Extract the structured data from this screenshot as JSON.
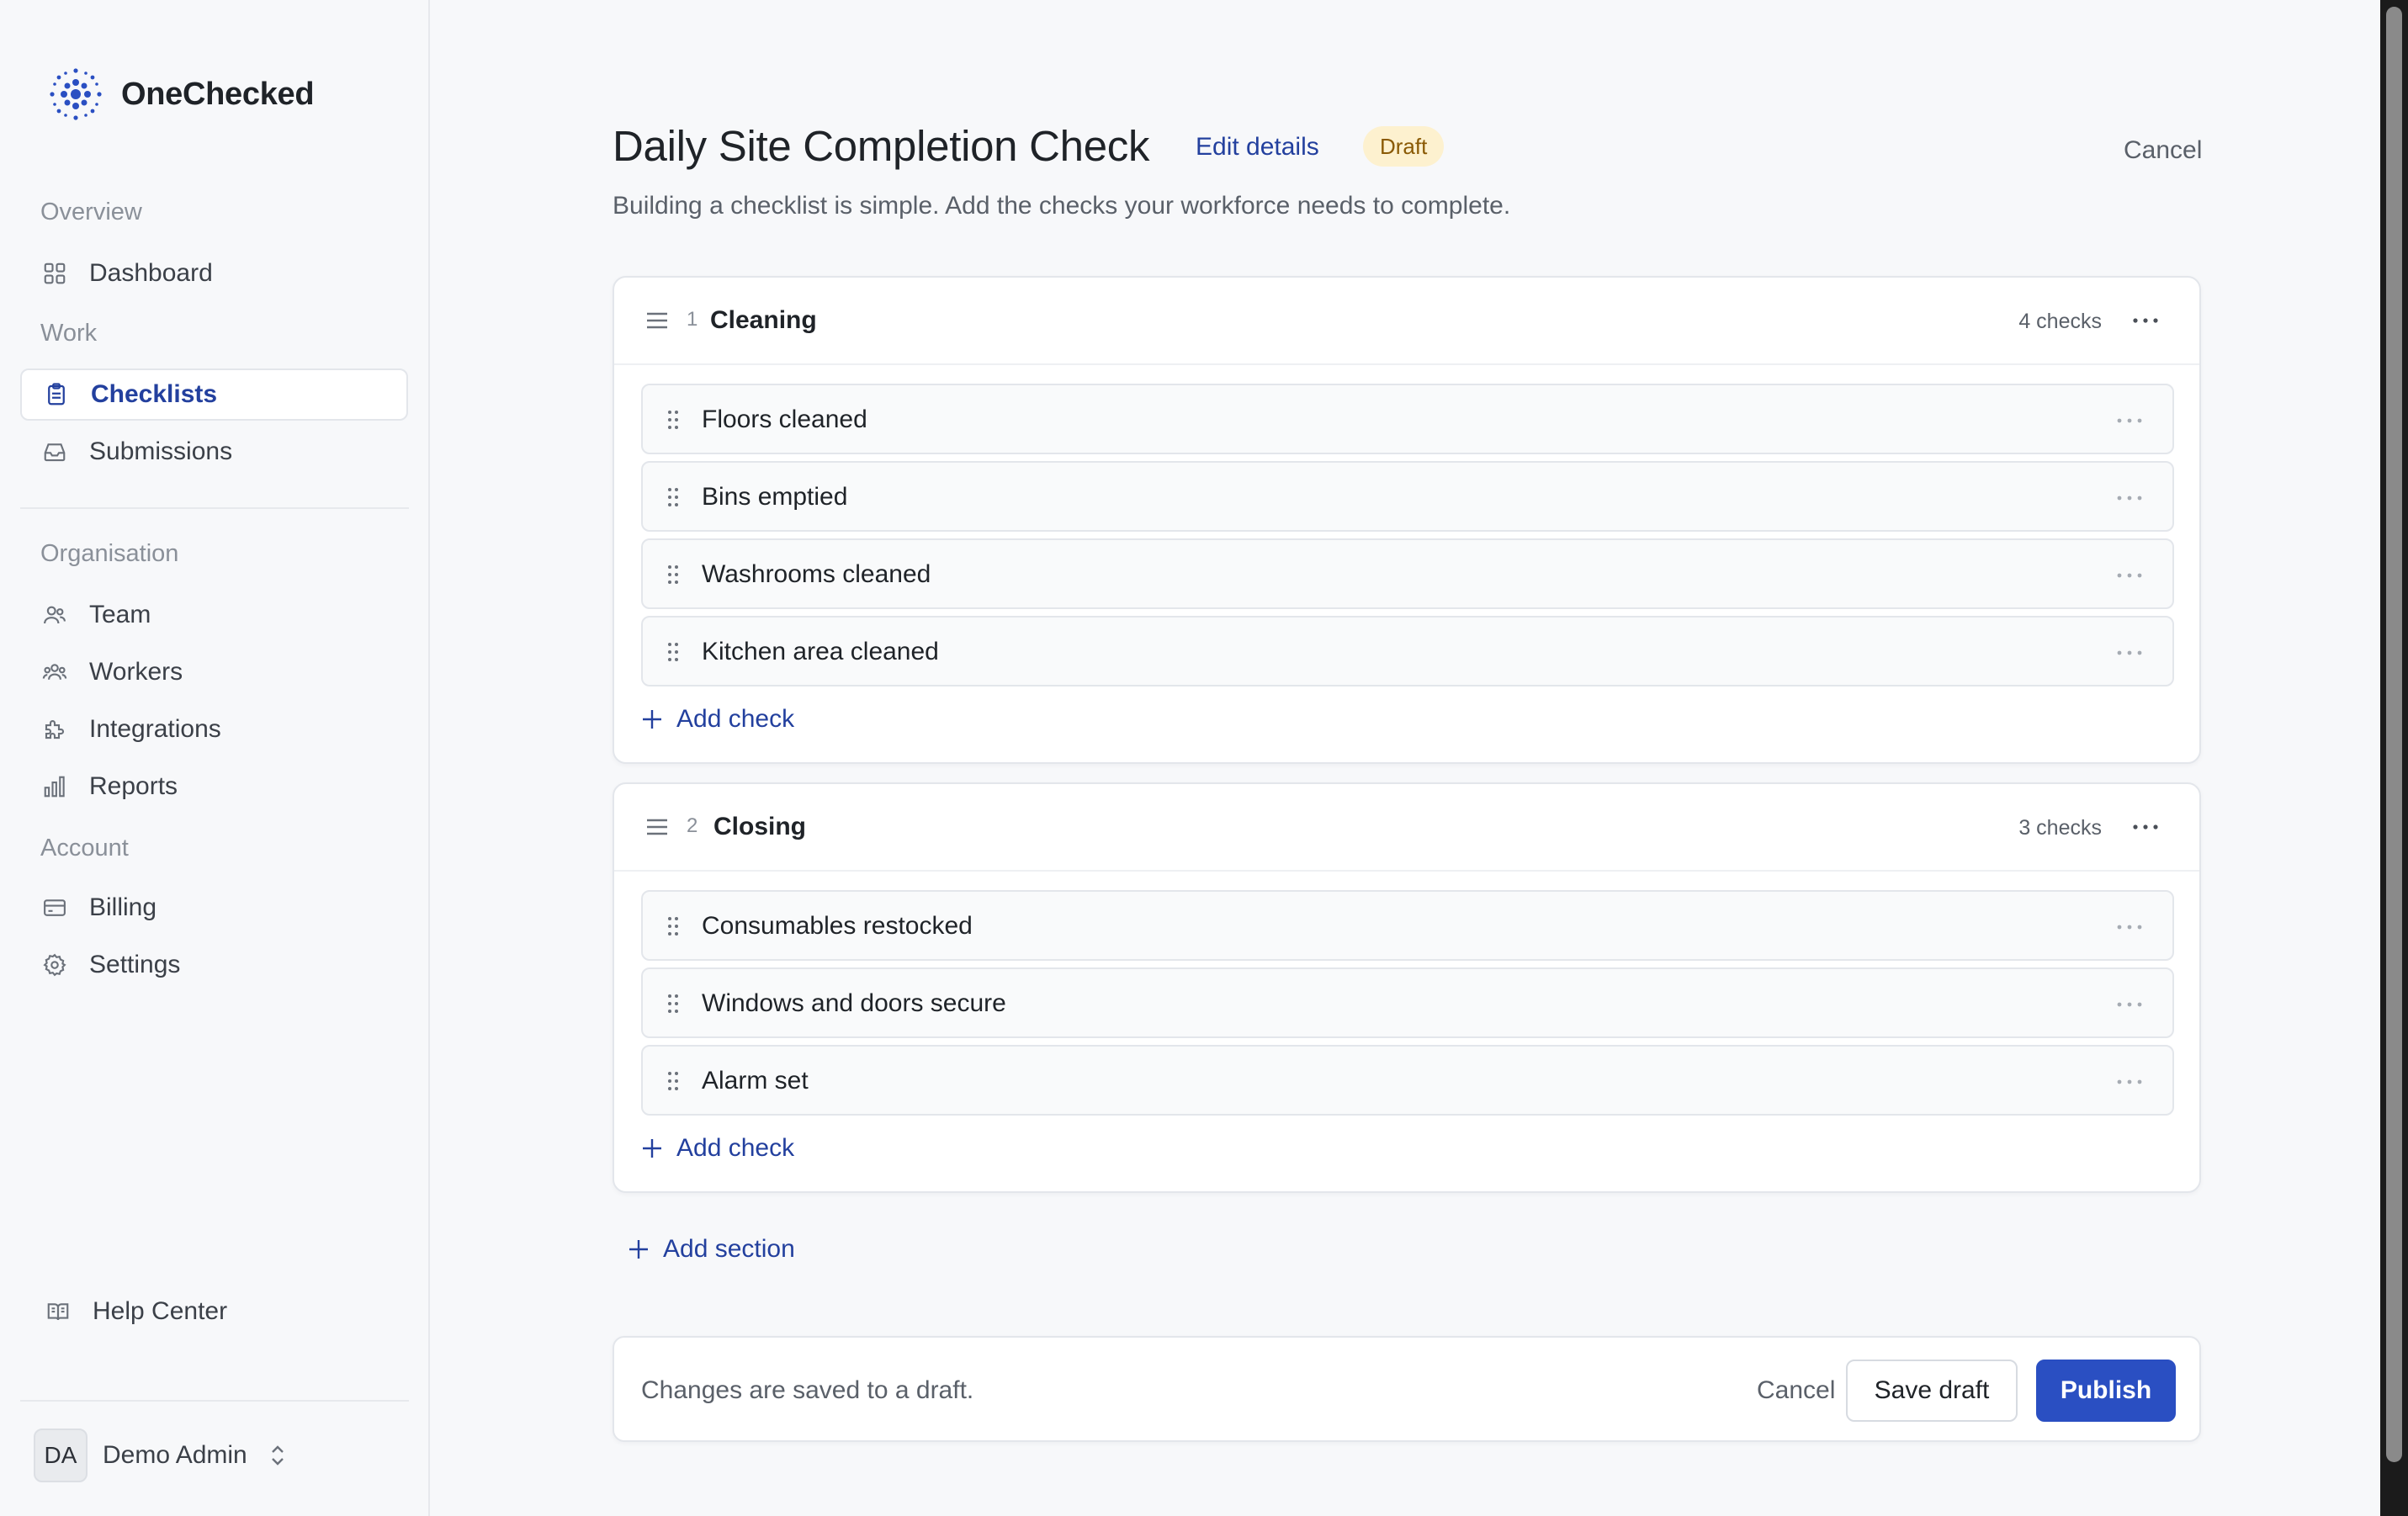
{
  "brand": {
    "name": "OneChecked",
    "logo_icon": "dots-logo-icon"
  },
  "sidebar": {
    "groups": {
      "overview": "Overview",
      "work": "Work",
      "organisation": "Organisation",
      "account": "Account"
    },
    "items": {
      "dashboard": {
        "label": "Dashboard",
        "icon": "grid-icon"
      },
      "checklists": {
        "label": "Checklists",
        "icon": "clipboard-icon",
        "active": true
      },
      "submissions": {
        "label": "Submissions",
        "icon": "inbox-icon"
      },
      "team": {
        "label": "Team",
        "icon": "users-icon"
      },
      "workers": {
        "label": "Workers",
        "icon": "user-group-icon"
      },
      "integrations": {
        "label": "Integrations",
        "icon": "puzzle-icon"
      },
      "reports": {
        "label": "Reports",
        "icon": "bar-chart-icon"
      },
      "billing": {
        "label": "Billing",
        "icon": "credit-card-icon"
      },
      "settings": {
        "label": "Settings",
        "icon": "gear-icon"
      }
    },
    "help": {
      "label": "Help Center",
      "icon": "book-icon"
    },
    "user": {
      "initials": "DA",
      "name": "Demo Admin"
    }
  },
  "header": {
    "title": "Daily Site Completion Check",
    "edit_label": "Edit details",
    "status_badge": "Draft",
    "cancel_label": "Cancel",
    "subtitle": "Building a checklist is simple. Add the checks your workforce needs to complete."
  },
  "sections": [
    {
      "number": "1",
      "title": "Cleaning",
      "count": "4 checks",
      "checks": [
        "Floors cleaned",
        "Bins emptied",
        "Washrooms cleaned",
        "Kitchen area cleaned"
      ],
      "add_label": "Add check"
    },
    {
      "number": "2",
      "title": "Closing",
      "count": "3 checks",
      "checks": [
        "Consumables restocked",
        "Windows and doors secure",
        "Alarm set"
      ],
      "add_label": "Add check"
    }
  ],
  "add_section_label": "Add section",
  "footer": {
    "note": "Changes are saved to a draft.",
    "cancel_label": "Cancel",
    "save_label": "Save draft",
    "publish_label": "Publish"
  },
  "colors": {
    "accent": "#23409e",
    "primary_button": "#2a4fc2",
    "badge_bg": "#fdf1cf",
    "badge_text": "#8a5a05"
  }
}
